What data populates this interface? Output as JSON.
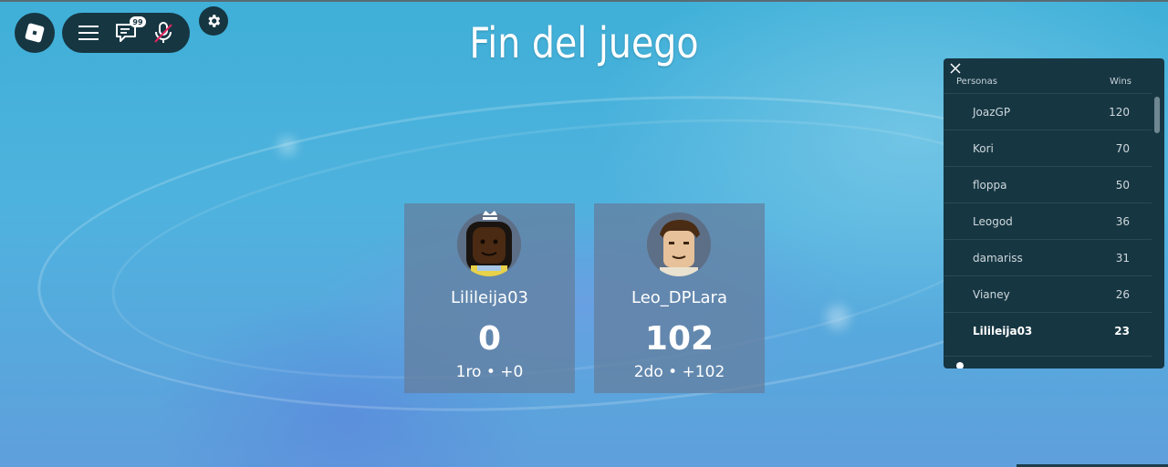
{
  "topbar": {
    "chat_badge": "99",
    "icons": [
      "roblox-logo-icon",
      "menu-icon",
      "chat-icon",
      "mic-muted-icon",
      "gear-icon"
    ]
  },
  "title": "Fin del juego",
  "players": [
    {
      "name": "Lilileija03",
      "score": "0",
      "rank_line": "1ro • +0",
      "crown": true
    },
    {
      "name": "Leo_DPLara",
      "score": "102",
      "rank_line": "2do • +102",
      "crown": false
    }
  ],
  "leaderboard": {
    "col_people": "Personas",
    "col_wins": "Wins",
    "rows": [
      {
        "name": "JoazGP",
        "wins": "120"
      },
      {
        "name": "Kori",
        "wins": "70"
      },
      {
        "name": "floppa",
        "wins": "50"
      },
      {
        "name": "Leogod",
        "wins": "36"
      },
      {
        "name": "damariss",
        "wins": "31"
      },
      {
        "name": "Vianey",
        "wins": "26"
      },
      {
        "name": "Lilileija03",
        "wins": "23",
        "highlight": true
      }
    ]
  },
  "colors": {
    "panel": "#163642",
    "card": "#647d9b",
    "text": "#ffffff"
  }
}
